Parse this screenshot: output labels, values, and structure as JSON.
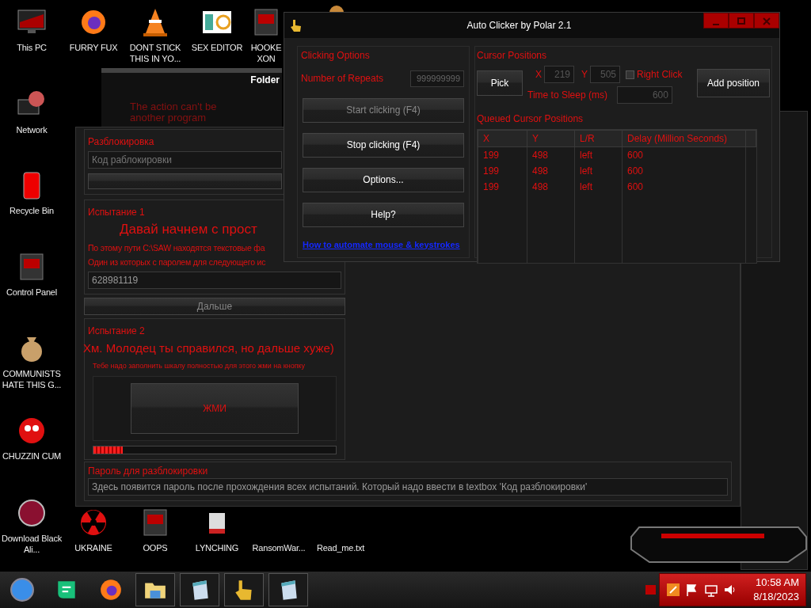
{
  "desktop_icons": [
    {
      "label": "This PC",
      "kind": "monitor"
    },
    {
      "label": "FURRY FUX",
      "kind": "flame"
    },
    {
      "label": "DONT STICK THIS IN YO...",
      "kind": "cone"
    },
    {
      "label": "SEX EDITOR",
      "kind": "tile"
    },
    {
      "label": "HOOKE XON",
      "kind": "panel"
    },
    {
      "label": "Network",
      "kind": "orb"
    },
    {
      "label": "Recycle Bin",
      "kind": "bin"
    },
    {
      "label": "Control Panel",
      "kind": "panel"
    },
    {
      "label": "COMMUNISTS HATE THIS G...",
      "kind": "bag"
    },
    {
      "label": "CHUZZIN CUM",
      "kind": "fuzz"
    },
    {
      "label": "Download Black Ali...",
      "kind": "disc"
    },
    {
      "label": "UKRAINE",
      "kind": "radiation"
    },
    {
      "label": "OOPS",
      "kind": "panel"
    },
    {
      "label": "LYNCHING",
      "kind": "file"
    },
    {
      "label": "RansomWar...",
      "kind": "none"
    },
    {
      "label": "Read_me.txt",
      "kind": "none"
    }
  ],
  "folder_dialog": {
    "title": "Folder",
    "message": [
      "The action can't be",
      "another program"
    ]
  },
  "unlock_window": {
    "unlock_group": {
      "title": "Разблокировка",
      "code_field": {
        "placeholder": "Код раблокировки"
      }
    },
    "trial_1": {
      "title": "Испытание 1",
      "heading": "Давай начнем с прост",
      "lines": [
        "По этому пути C:\\SAW находятся текстовые фа",
        "Один из которых с паролем для следующего ис"
      ],
      "answer": "628981119",
      "next_button": {
        "label": "Дальше",
        "disabled": true
      }
    },
    "trial_2": {
      "title": "Испытание 2",
      "heading": "Хм. Молодец ты справился, но дальше хуже)",
      "instruction": "Тебе надо заполнить шкалу полностью для этого жми на кнопку",
      "press_button": "ЖМИ",
      "progress": {
        "level": 0.12
      }
    },
    "password_group": {
      "title": "Пароль для разблокировки",
      "text": "Здесь появится пароль после прохождения всех испытаний. Который надо ввести в textbox 'Код разблокировки'"
    }
  },
  "auto_clicker": {
    "title": "Auto Clicker by Polar 2.1",
    "clicking_options": {
      "title": "Clicking Options",
      "repeats_label": "Number of Repeats",
      "repeats_value": "999999999",
      "buttons": [
        {
          "label": "Start clicking (F4)",
          "disabled": true
        },
        {
          "label": "Stop clicking (F4)",
          "disabled": false
        },
        {
          "label": "Options...",
          "disabled": false
        },
        {
          "label": "Help?",
          "disabled": false
        }
      ],
      "link": "How to automate mouse & keystrokes"
    },
    "cursor_positions": {
      "title": "Cursor Positions",
      "pick_button": "Pick",
      "x_label": "X",
      "x_value": "219",
      "y_label": "Y",
      "y_value": "505",
      "right_click": {
        "label": "Right Click",
        "checked": false
      },
      "sleep_label": "Time to Sleep (ms)",
      "sleep_value": "600",
      "add_button": "Add position"
    },
    "queue": {
      "title": "Queued Cursor Positions",
      "columns": [
        "X",
        "Y",
        "L/R",
        "Delay (Million Seconds)"
      ],
      "rows": [
        [
          "199",
          "498",
          "left",
          "600"
        ],
        [
          "199",
          "498",
          "left",
          "600"
        ],
        [
          "199",
          "498",
          "left",
          "600"
        ]
      ]
    }
  },
  "taskbar": {
    "items": [
      {
        "kind": "orb",
        "open": false
      },
      {
        "kind": "chat",
        "open": false
      },
      {
        "kind": "flame",
        "open": false
      },
      {
        "kind": "folder",
        "open": true
      },
      {
        "kind": "notepad",
        "open": true
      },
      {
        "kind": "hand",
        "open": true
      },
      {
        "kind": "notepad",
        "open": true
      }
    ],
    "tray": {
      "time": "10:58 AM",
      "date": "8/18/2023"
    }
  }
}
